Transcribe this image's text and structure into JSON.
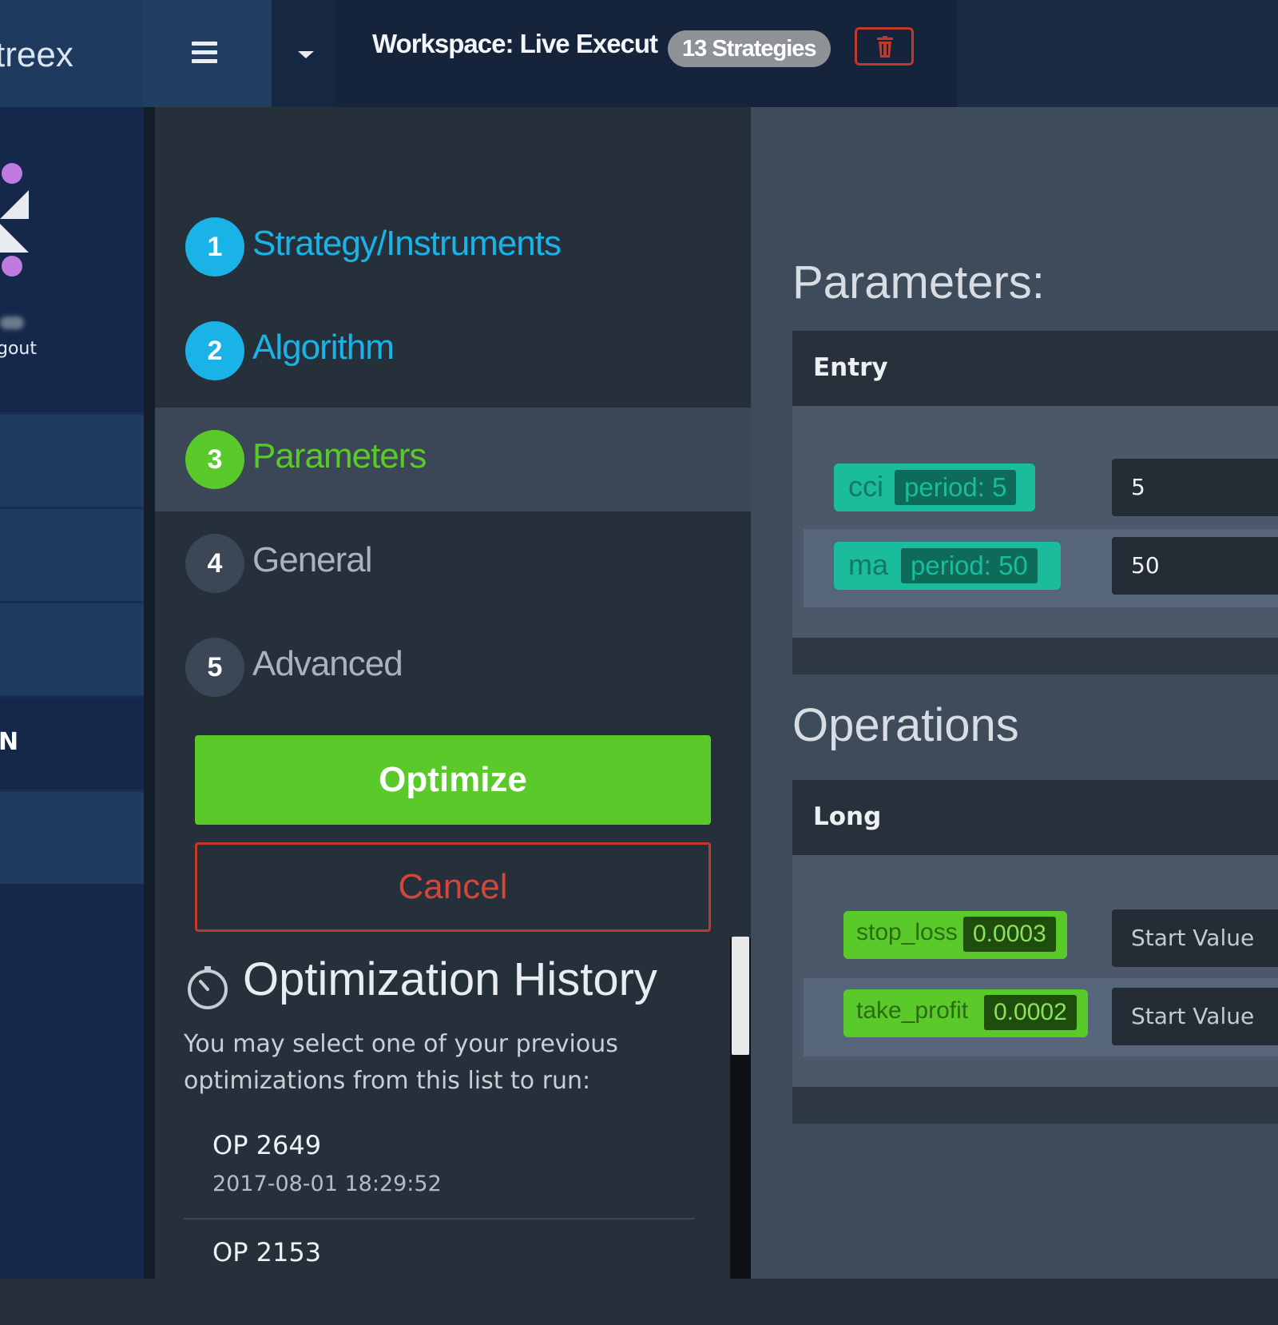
{
  "topbar": {
    "brand": "treex",
    "workspace_title": "Workspace: Live Execut",
    "strategies_badge": "13 Strategies"
  },
  "leftnav": {
    "logout": "gout",
    "items": [
      {
        "label": ""
      },
      {
        "label": ""
      },
      {
        "label": ""
      },
      {
        "label": "N"
      },
      {
        "label": ""
      }
    ]
  },
  "wizard": {
    "steps": [
      {
        "num": "1",
        "label": "Strategy/Instruments",
        "state": "done",
        "color": "#1ab3e8"
      },
      {
        "num": "2",
        "label": "Algorithm",
        "state": "done",
        "color": "#1ab3e8"
      },
      {
        "num": "3",
        "label": "Parameters",
        "state": "active",
        "color": "#5ac92a"
      },
      {
        "num": "4",
        "label": "General",
        "state": "pending",
        "color": "#3b4756"
      },
      {
        "num": "5",
        "label": "Advanced",
        "state": "pending",
        "color": "#3b4756"
      }
    ],
    "optimize_label": "Optimize",
    "cancel_label": "Cancel"
  },
  "history": {
    "title": "Optimization History",
    "description": "You may select one of your previous optimizations from this list to run:",
    "items": [
      {
        "name": "OP 2649",
        "date": "2017-08-01 18:29:52"
      },
      {
        "name": "OP 2153",
        "date": ""
      }
    ]
  },
  "main": {
    "parameters_title": "Parameters:",
    "entry_header": "Entry",
    "entry_params": [
      {
        "key": "cci",
        "tag": "period: 5",
        "value": "5"
      },
      {
        "key": "ma",
        "tag": "period: 50",
        "value": "50"
      }
    ],
    "operations_title": "Operations",
    "long_header": "Long",
    "long_params": [
      {
        "key": "stop_loss",
        "tag": "0.0003",
        "placeholder": "Start Value"
      },
      {
        "key": "take_profit",
        "tag": "0.0002",
        "placeholder": "Start Value"
      }
    ]
  },
  "colors": {
    "accent_blue": "#1ab3e8",
    "accent_green": "#5ac92a",
    "danger_red": "#c0392b",
    "teal": "#1abc9c"
  }
}
